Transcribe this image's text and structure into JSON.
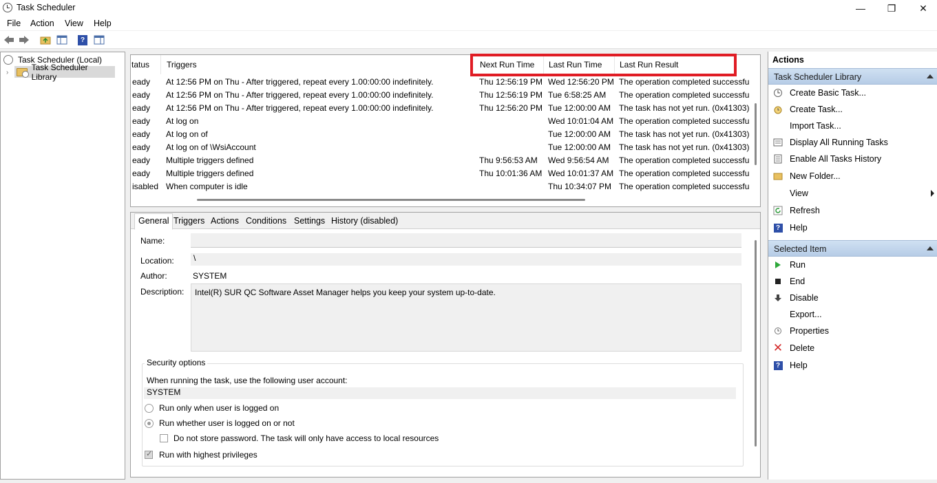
{
  "window": {
    "title": "Task Scheduler"
  },
  "menu": [
    "File",
    "Action",
    "View",
    "Help"
  ],
  "tree": {
    "root": "Task Scheduler (Local)",
    "library": "Task Scheduler Library"
  },
  "tasklist": {
    "columns": [
      "tatus",
      "Triggers",
      "Next Run Time",
      "Last Run Time",
      "Last Run Result"
    ],
    "rows": [
      {
        "status": "eady",
        "trigger": "At 12:56 PM on Thu - After triggered, repeat every 1.00:00:00 indefinitely.",
        "next": "Thu 12:56:19 PM",
        "last": "Wed 12:56:20 PM",
        "result": "The operation completed successfu"
      },
      {
        "status": "eady",
        "trigger": "At 12:56 PM on Thu - After triggered, repeat every 1.00:00:00 indefinitely.",
        "next": "Thu 12:56:19 PM",
        "last": "Tue 6:58:25 AM",
        "result": "The operation completed successfu"
      },
      {
        "status": "eady",
        "trigger": "At 12:56 PM on Thu - After triggered, repeat every 1.00:00:00 indefinitely.",
        "next": "Thu 12:56:20 PM",
        "last": "Tue 12:00:00 AM",
        "result": "The task has not yet run. (0x41303)"
      },
      {
        "status": "eady",
        "trigger": "At log on",
        "next": "",
        "last": "Wed 10:01:04 AM",
        "result": "The operation completed successfu"
      },
      {
        "status": "eady",
        "trigger": "At log on of",
        "next": "",
        "last": "Tue 12:00:00 AM",
        "result": "The task has not yet run. (0x41303)"
      },
      {
        "status": "eady",
        "trigger": "At log on of             \\WsiAccount",
        "next": "",
        "last": "Tue 12:00:00 AM",
        "result": "The task has not yet run. (0x41303)"
      },
      {
        "status": "eady",
        "trigger": "Multiple triggers defined",
        "next": "Thu 9:56:53 AM",
        "last": "Wed 9:56:54 AM",
        "result": "The operation completed successfu"
      },
      {
        "status": "eady",
        "trigger": "Multiple triggers defined",
        "next": "Thu 10:01:36 AM",
        "last": "Wed 10:01:37 AM",
        "result": "The operation completed successfu"
      },
      {
        "status": "isabled",
        "trigger": "When computer is idle",
        "next": "",
        "last": "Thu 10:34:07 PM",
        "result": "The operation completed successfu"
      }
    ]
  },
  "details": {
    "tabs": [
      "General",
      "Triggers",
      "Actions",
      "Conditions",
      "Settings",
      "History (disabled)"
    ],
    "name_label": "Name:",
    "name_value": "",
    "location_label": "Location:",
    "location_value": "\\",
    "author_label": "Author:",
    "author_value": "SYSTEM",
    "description_label": "Description:",
    "description_value": "Intel(R) SUR QC Software Asset Manager helps you keep your system up-to-date.",
    "security_title": "Security options",
    "account_prompt": "When running the task, use the following user account:",
    "account_value": "SYSTEM",
    "opt_logged_on": "Run only when user is logged on",
    "opt_whether": "Run whether user is logged on or not",
    "opt_no_password": "Do not store password.  The task will only have access to local resources",
    "opt_highest": "Run with highest privileges"
  },
  "actions": {
    "title": "Actions",
    "section1": "Task Scheduler Library",
    "items1": [
      "Create Basic Task...",
      "Create Task...",
      "Import Task...",
      "Display All Running Tasks",
      "Enable All Tasks History",
      "New Folder...",
      "View",
      "Refresh",
      "Help"
    ],
    "section2": "Selected Item",
    "items2": [
      "Run",
      "End",
      "Disable",
      "Export...",
      "Properties",
      "Delete",
      "Help"
    ]
  }
}
